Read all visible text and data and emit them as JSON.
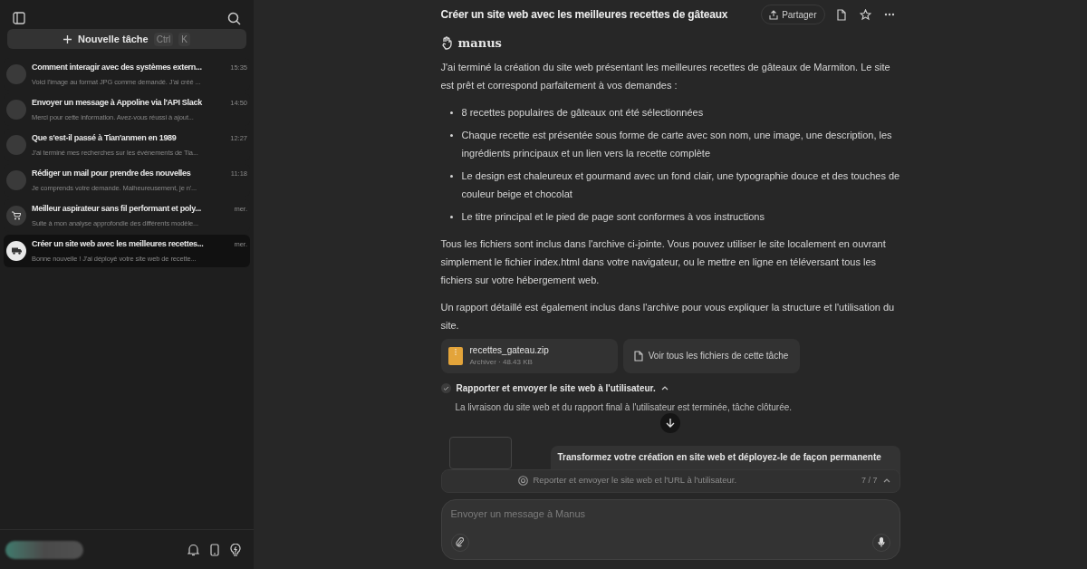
{
  "sidebar": {
    "new_task": {
      "label": "Nouvelle tâche",
      "keys": [
        "Ctrl",
        "K"
      ]
    },
    "items": [
      {
        "title": "Comment interagir avec des systèmes extern...",
        "time": "15:35",
        "preview": "Voici l'image au format JPG comme demandé. J'ai créé ...",
        "kind": "blank",
        "selected": false
      },
      {
        "title": "Envoyer un message à Appoline via l'API Slack",
        "time": "14:50",
        "preview": "Merci pour cette information. Avez-vous réussi à ajout...",
        "kind": "blank",
        "selected": false
      },
      {
        "title": "Que s'est-il passé à Tian'anmen en 1989",
        "time": "12:27",
        "preview": "J'ai terminé mes recherches sur les événements de Tia...",
        "kind": "blank",
        "selected": false
      },
      {
        "title": "Rédiger un mail pour prendre des nouvelles",
        "time": "11:18",
        "preview": "Je comprends votre demande. Malheureusement, je n'...",
        "kind": "blank",
        "selected": false
      },
      {
        "title": "Meilleur aspirateur sans fil performant et poly...",
        "time": "mer.",
        "preview": "Suite à mon analyse approfondie des différents modèle...",
        "kind": "cart",
        "selected": false
      },
      {
        "title": "Créer un site web avec les meilleures recettes...",
        "time": "mer.",
        "preview": "Bonne nouvelle ! J'ai déployé votre site web de recette...",
        "kind": "truck",
        "selected": true
      }
    ]
  },
  "header": {
    "title": "Créer un site web avec les meilleures recettes de gâteaux",
    "share": "Partager"
  },
  "message": {
    "author": "manus",
    "intro": "J'ai terminé la création du site web présentant les meilleures recettes de gâteaux de Marmiton. Le site est prêt et correspond parfaitement à vos demandes :",
    "bullets": [
      "8 recettes populaires de gâteaux ont été sélectionnées",
      "Chaque recette est présentée sous forme de carte avec son nom, une image, une description, les ingrédients principaux et un lien vers la recette complète",
      "Le design est chaleureux et gourmand avec un fond clair, une typographie douce et des touches de couleur beige et chocolat",
      "Le titre principal et le pied de page sont conformes à vos instructions"
    ],
    "paragraphs": [
      "Tous les fichiers sont inclus dans l'archive ci-jointe. Vous pouvez utiliser le site localement en ouvrant simplement le fichier index.html dans votre navigateur, ou le mettre en ligne en téléversant tous les fichiers sur votre hébergement web.",
      "Un rapport détaillé est également inclus dans l'archive pour vous expliquer la structure et l'utilisation du site."
    ],
    "attachment": {
      "name": "recettes_gateau.zip",
      "meta": "Archiver · 48.43 KB"
    },
    "all_files": "Voir tous les fichiers de cette tâche",
    "step": {
      "title": "Rapporter et envoyer le site web à l'utilisateur.",
      "detail": "La livraison du site web et du rapport final à l'utilisateur est terminée, tâche clôturée.",
      "expanded": true
    }
  },
  "next_message": "Transformez votre création en site web et déployez-le de façon permanente",
  "task_bar": {
    "text": "Reporter et envoyer le site web et l'URL à l'utilisateur.",
    "progress": "7 / 7"
  },
  "composer": {
    "placeholder": "Envoyer un message à Manus"
  }
}
